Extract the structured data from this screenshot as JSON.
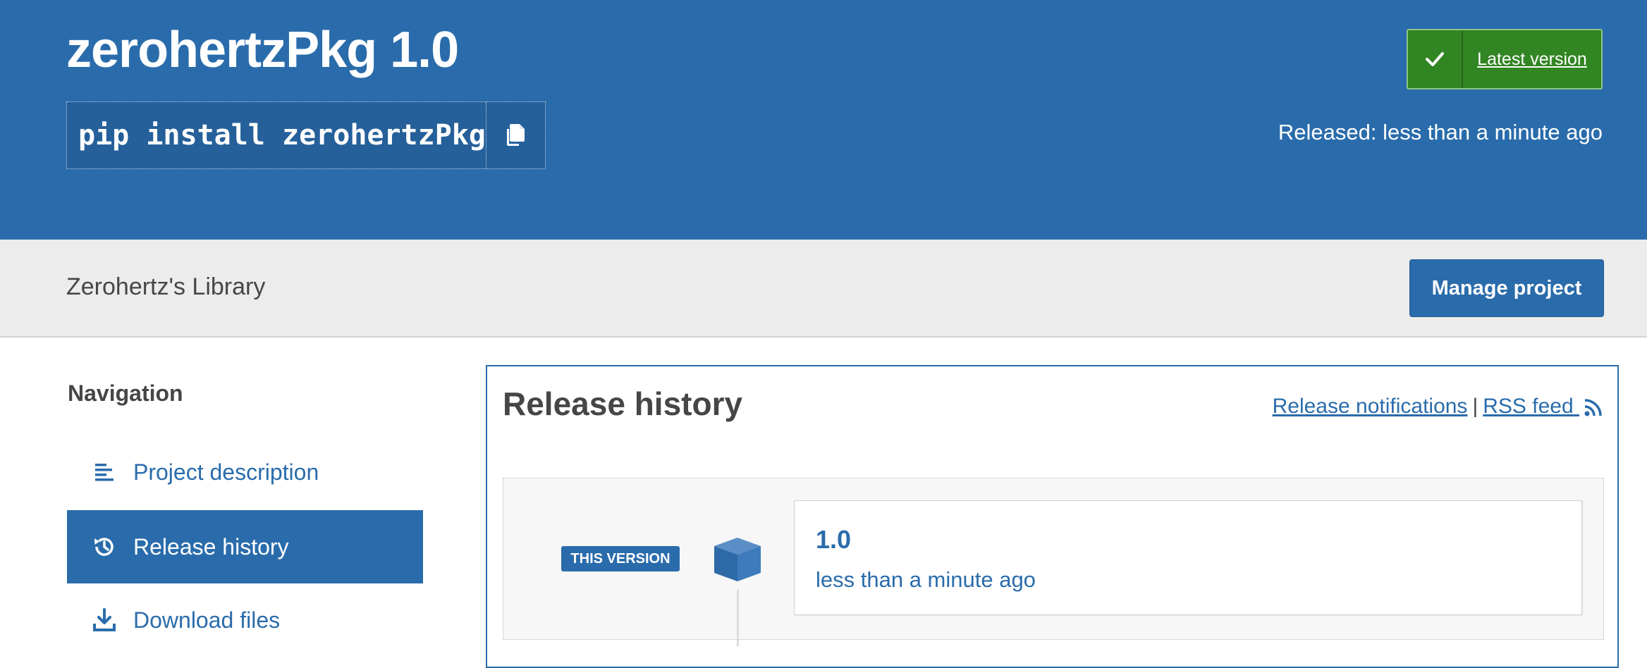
{
  "header": {
    "package_title": "zerohertzPkg 1.0",
    "pip_command": "pip install zerohertzPkg",
    "copy_icon": "copy-icon",
    "latest_badge": {
      "icon": "check-icon",
      "label": "Latest version"
    },
    "released": "Released: less than a minute ago"
  },
  "subheader": {
    "summary": "Zerohertz's Library",
    "manage_label": "Manage project"
  },
  "navigation": {
    "heading": "Navigation",
    "items": [
      {
        "label": "Project description",
        "icon": "align-left-icon",
        "active": false
      },
      {
        "label": "Release history",
        "icon": "history-icon",
        "active": true
      },
      {
        "label": "Download files",
        "icon": "download-icon",
        "active": false
      }
    ]
  },
  "release_history": {
    "title": "Release history",
    "notifications_link": "Release notifications",
    "separator": "|",
    "rss_link": "RSS feed",
    "rss_icon": "rss-icon",
    "releases": [
      {
        "badge": "THIS VERSION",
        "icon": "package-box-icon",
        "version": "1.0",
        "date": "less than a minute ago"
      }
    ]
  },
  "colors": {
    "brand_blue": "#2a6cab",
    "latest_green": "#318522",
    "subheader_gray": "#ececec",
    "text": "#464646"
  }
}
